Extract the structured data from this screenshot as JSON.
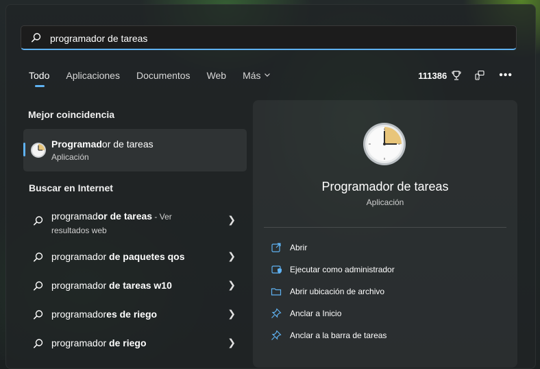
{
  "search": {
    "value": "programador de tareas",
    "icon": "search-icon"
  },
  "tabs": [
    {
      "label": "Todo",
      "active": true
    },
    {
      "label": "Aplicaciones"
    },
    {
      "label": "Documentos"
    },
    {
      "label": "Web"
    },
    {
      "label": "Más"
    }
  ],
  "toolbar": {
    "points": "111386",
    "points_icon": "trophy-icon",
    "feedback_icon": "share-icon",
    "more_label": "•••"
  },
  "best_match": {
    "heading": "Mejor coincidencia",
    "name_bold": "Programad",
    "name_rest": "or de tareas",
    "type": "Aplicación",
    "icon": "clock-icon"
  },
  "web": {
    "heading": "Buscar en Internet",
    "results": [
      {
        "plain": "programad",
        "bold": "or de tareas",
        "suffix": " - Ver",
        "line2": "resultados web"
      },
      {
        "plain": "programador ",
        "bold": "de paquetes qos",
        "suffix": "",
        "line2": ""
      },
      {
        "plain": "programador ",
        "bold": "de tareas w10",
        "suffix": "",
        "line2": ""
      },
      {
        "plain": "programador",
        "bold": "es de riego",
        "suffix": "",
        "line2": ""
      },
      {
        "plain": "programador ",
        "bold": "de riego",
        "suffix": "",
        "line2": ""
      }
    ]
  },
  "detail": {
    "title": "Programador de tareas",
    "type": "Aplicación",
    "actions": [
      {
        "label": "Abrir",
        "icon": "open-icon"
      },
      {
        "label": "Ejecutar como administrador",
        "icon": "shield-icon"
      },
      {
        "label": "Abrir ubicación de archivo",
        "icon": "folder-icon"
      },
      {
        "label": "Anclar a Inicio",
        "icon": "pin-icon"
      },
      {
        "label": "Anclar a la barra de tareas",
        "icon": "pin-icon"
      }
    ]
  },
  "colors": {
    "accent": "#5fb2f2"
  }
}
